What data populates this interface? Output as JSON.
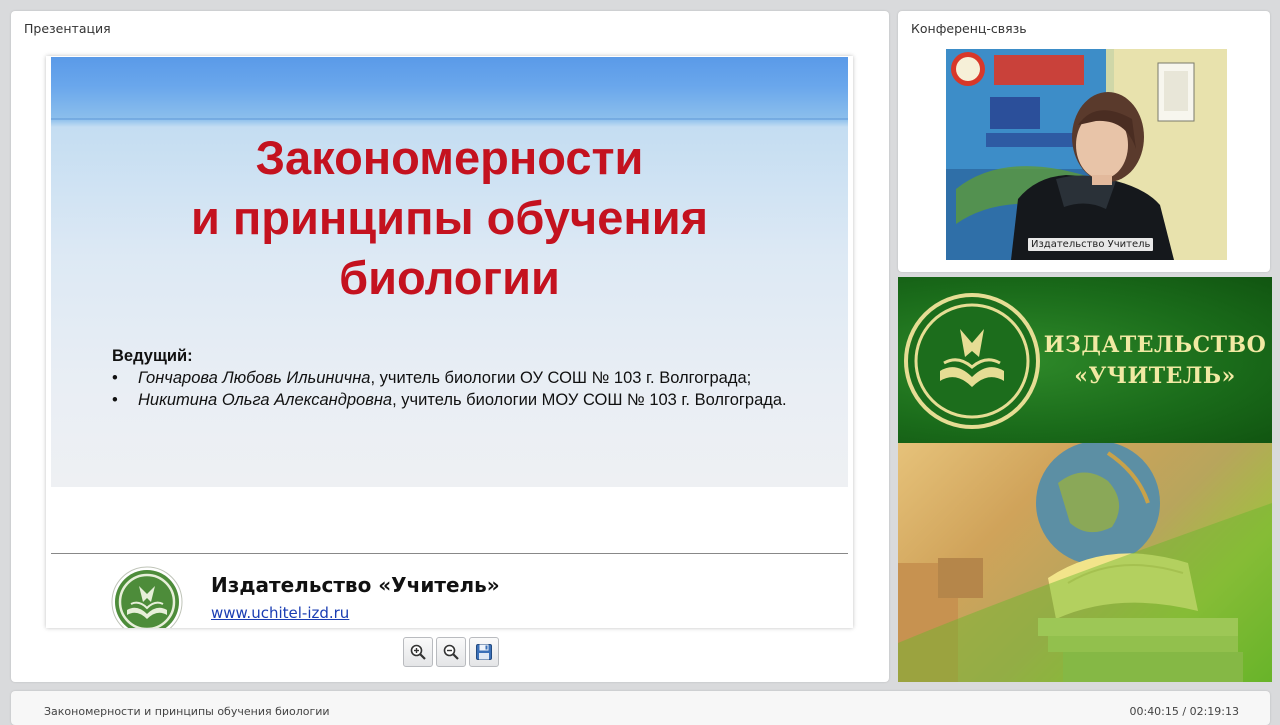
{
  "presentation_panel": {
    "title": "Презентация"
  },
  "slide": {
    "title_lines": [
      "Закономерности",
      "и принципы обучения",
      "биологии"
    ],
    "presenters_heading": "Ведущий:",
    "presenters": [
      {
        "name": "Гончарова Любовь Ильинична",
        "role": ", учитель биологии ОУ СОШ № 103 г. Волгограда;"
      },
      {
        "name": "Никитина Ольга Александровна",
        "role": ", учитель биологии МОУ СОШ № 103 г. Волгограда."
      }
    ],
    "publisher_name": "Издательство «Учитель»",
    "publisher_url": "www.uchitel-izd.ru"
  },
  "toolbar": {
    "icons": [
      "zoom-in-icon",
      "zoom-out-icon",
      "save-icon"
    ]
  },
  "conference_panel": {
    "title": "Конференц-связь",
    "video_label": "Издательство Учитель"
  },
  "banner": {
    "name_line1": "ИЗДАТЕЛЬСТВО",
    "name_line2": "«УЧИТЕЛЬ»"
  },
  "footer": {
    "title": "Закономерности и принципы обучения биологии",
    "time": "00:40:15 / 02:19:13"
  },
  "colors": {
    "slide_title": "#c4121f",
    "banner_green": "#1b6a1b",
    "banner_text": "#f1e9a3",
    "link": "#1a3db3"
  }
}
